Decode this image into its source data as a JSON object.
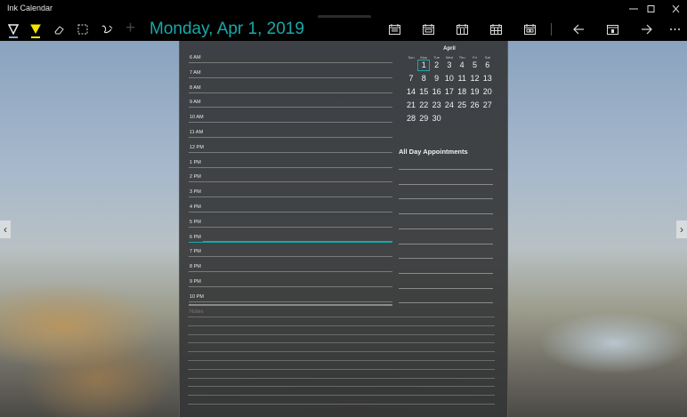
{
  "window": {
    "title": "Ink Calendar"
  },
  "toolbar": {
    "date_title": "Monday, Apr 1, 2019",
    "plus_label": "+",
    "accent_color": "#1aa8a8",
    "left_tools": [
      {
        "name": "ballpoint-pen-icon",
        "active": true
      },
      {
        "name": "highlighter-icon",
        "active": false
      },
      {
        "name": "eraser-icon",
        "active": false
      },
      {
        "name": "selection-icon",
        "active": false
      },
      {
        "name": "touch-writing-icon",
        "active": false
      }
    ],
    "right_tools": [
      "calendar-day-view-icon",
      "calendar-week-view-icon",
      "calendar-workweek-view-icon",
      "calendar-month-view-icon",
      "calendar-agenda-view-icon",
      "back-arrow-icon",
      "today-icon",
      "forward-arrow-icon",
      "more-icon"
    ]
  },
  "day_view": {
    "hours": [
      "6 AM",
      "7 AM",
      "8 AM",
      "9 AM",
      "10 AM",
      "11 AM",
      "12 PM",
      "1 PM",
      "2 PM",
      "3 PM",
      "4 PM",
      "5 PM",
      "6 PM",
      "7 PM",
      "8 PM",
      "9 PM",
      "10 PM"
    ],
    "current_hour": "6 PM",
    "notes_label": "Notes"
  },
  "mini_calendar": {
    "month": "April",
    "weekdays": [
      "Sun",
      "Mon",
      "Tue",
      "Wed",
      "Thu",
      "Fri",
      "Sat"
    ],
    "weeks": [
      [
        "",
        "1",
        "2",
        "3",
        "4",
        "5",
        "6"
      ],
      [
        "7",
        "8",
        "9",
        "10",
        "11",
        "12",
        "13"
      ],
      [
        "14",
        "15",
        "16",
        "17",
        "18",
        "19",
        "20"
      ],
      [
        "21",
        "22",
        "23",
        "24",
        "25",
        "26",
        "27"
      ],
      [
        "28",
        "29",
        "30",
        "",
        "",
        "",
        ""
      ]
    ],
    "selected_day": "1"
  },
  "all_day": {
    "title": "All Day Appointments"
  }
}
